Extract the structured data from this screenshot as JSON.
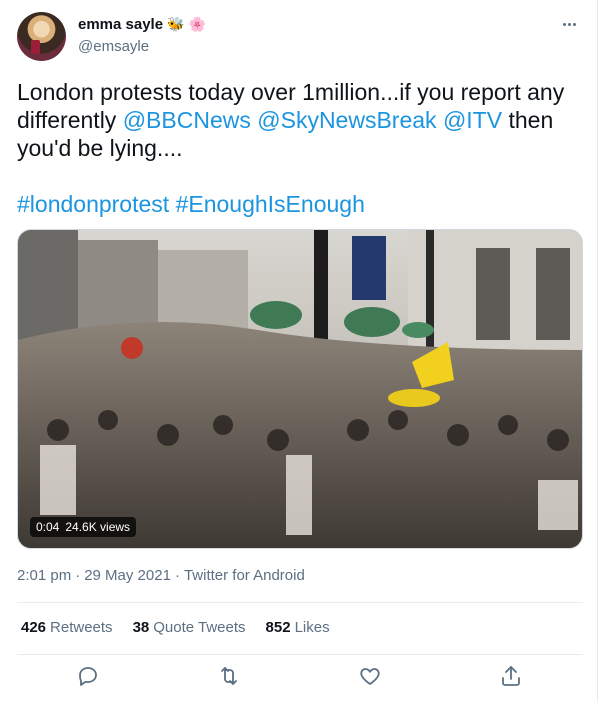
{
  "user": {
    "display_name": "emma sayle",
    "name_emoji": [
      "🐝",
      "🌸"
    ],
    "handle": "@emsayle"
  },
  "tweet": {
    "text_part1": "London protests today over 1million...if you report any differently ",
    "mention1": "@BBCNews",
    "mention2": "@SkyNewsBreak",
    "mention3": "@ITV",
    "text_part2": " then you'd be lying....",
    "hashtag1": "#londonprotest",
    "hashtag2": "#EnoughIsEnough"
  },
  "media": {
    "duration": "0:04",
    "views": "24.6K views"
  },
  "meta": {
    "time": "2:01 pm",
    "separator1": "·",
    "date": "29 May 2021",
    "separator2": "·",
    "source": "Twitter for Android"
  },
  "stats": {
    "retweets_count": "426",
    "retweets_label": "Retweets",
    "quotes_count": "38",
    "quotes_label": "Quote Tweets",
    "likes_count": "852",
    "likes_label": "Likes"
  },
  "icons": {
    "more": "more-options-icon",
    "reply": "reply-icon",
    "retweet": "retweet-icon",
    "like": "like-icon",
    "share": "share-icon"
  },
  "colors": {
    "link": "#1b95e0",
    "muted": "#5b7083",
    "text": "#0f1419"
  }
}
